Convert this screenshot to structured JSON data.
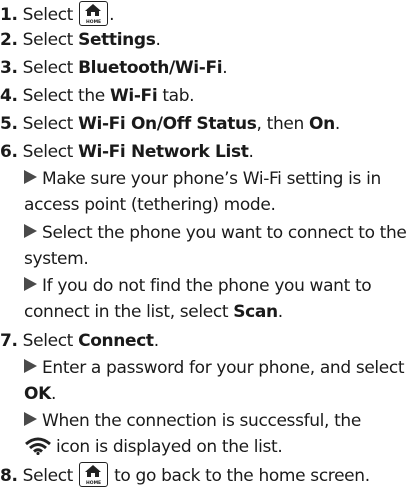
{
  "steps": {
    "s1": {
      "num": "1.",
      "pre": "Select ",
      "post": "."
    },
    "s2": {
      "num": "2.",
      "pre": "Select ",
      "bold": "Settings",
      "post": "."
    },
    "s3": {
      "num": "3.",
      "pre": "Select ",
      "bold": "Bluetooth/Wi-Fi",
      "post": "."
    },
    "s4": {
      "num": "4.",
      "pre": "Select the ",
      "bold": "Wi-Fi",
      "post": " tab."
    },
    "s5": {
      "num": "5.",
      "pre": "Select ",
      "bold": "Wi-Fi On/Off Status",
      "mid": ", then ",
      "bold2": "On",
      "post": "."
    },
    "s6": {
      "num": "6.",
      "pre": "Select ",
      "bold": "Wi-Fi Network List",
      "post": "."
    },
    "s7": {
      "num": "7.",
      "pre": "Select ",
      "bold": "Connect",
      "post": "."
    },
    "s8": {
      "num": "8.",
      "pre": "Select ",
      "post": " to go back to the home screen."
    }
  },
  "substeps": {
    "b6a": "Make sure your phone’s Wi-Fi setting is in access point (tethering) mode.",
    "b6b": "Select the phone you want to connect to the system.",
    "b6c_pre": "If you do not find the phone you want to connect in the list, select ",
    "b6c_bold": "Scan",
    "b6c_post": ".",
    "b7a_pre": "Enter a password for your phone, and select ",
    "b7a_bold": "OK",
    "b7a_post": ".",
    "b7b_pre": "When the connection is successful, the",
    "b7b_post": "icon is displayed on the list."
  },
  "icons": {
    "home_label": "HOME",
    "home": "home-icon",
    "wifi": "wifi-icon",
    "arrow": "arrow-bullet-icon"
  }
}
